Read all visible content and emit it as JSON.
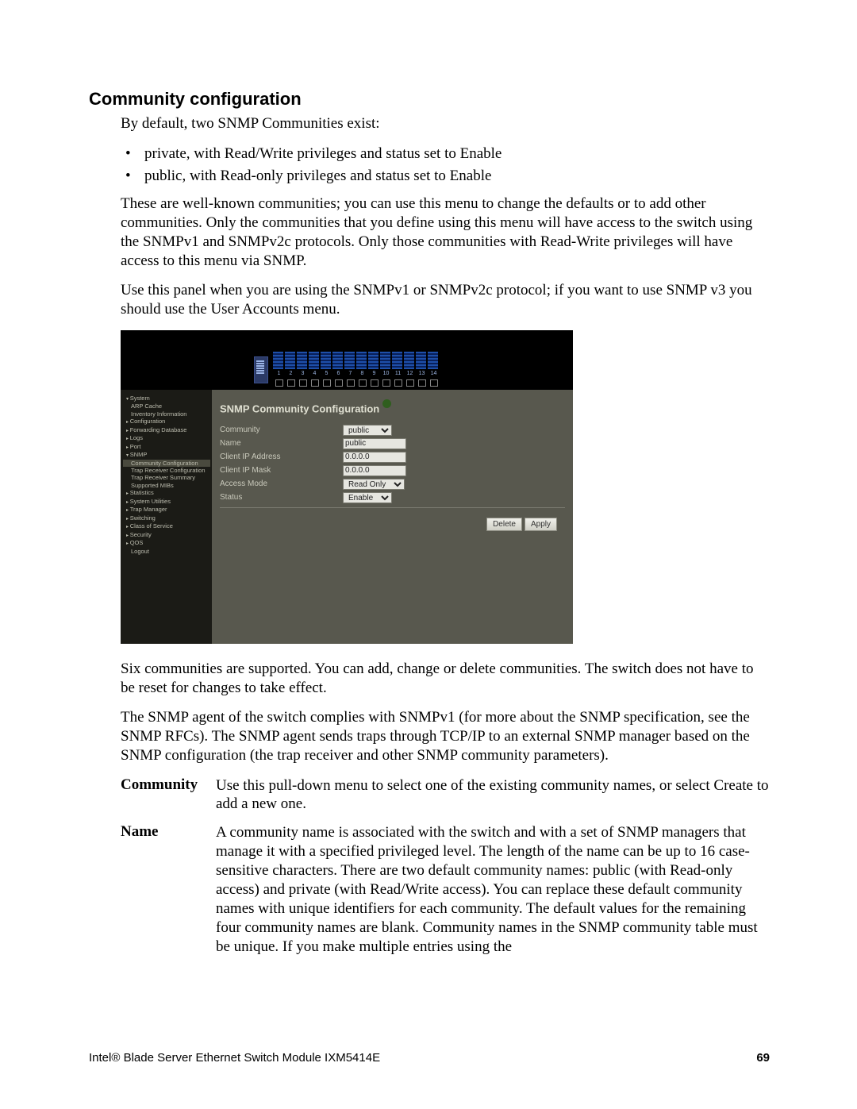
{
  "section_title": "Community configuration",
  "intro": "By default, two SNMP Communities exist:",
  "bullets": [
    "private, with Read/Write privileges and status set to Enable",
    "public, with Read-only privileges and status set to Enable"
  ],
  "para1": "These are well-known communities; you can use this menu to change the defaults or to add other communities. Only the communities that you define using this menu will have access to the switch using the SNMPv1 and SNMPv2c protocols. Only those communities with Read-Write privileges will have access to this menu via SNMP.",
  "para2": "Use this panel when you are using the SNMPv1 or SNMPv2c protocol; if you want to use SNMP v3 you should use the User Accounts menu.",
  "para3": "Six communities are supported. You can add, change or delete communities. The switch does not have to be reset for changes to take effect.",
  "para4": "The SNMP agent of the switch complies with SNMPv1 (for more about the SNMP specification, see the SNMP RFCs). The SNMP agent sends traps through TCP/IP to an external SNMP manager based on the SNMP configuration (the trap receiver and other SNMP community parameters).",
  "ports": [
    "1",
    "2",
    "3",
    "4",
    "5",
    "6",
    "7",
    "8",
    "9",
    "10",
    "11",
    "12",
    "13",
    "14"
  ],
  "nav_items": [
    {
      "label": "System",
      "cls": "n1 trid"
    },
    {
      "label": "ARP Cache",
      "cls": "n2"
    },
    {
      "label": "Inventory Information",
      "cls": "n2"
    },
    {
      "label": "Configuration",
      "cls": "n1 tri"
    },
    {
      "label": "Forwarding Database",
      "cls": "n1 tri"
    },
    {
      "label": "Logs",
      "cls": "n1 tri"
    },
    {
      "label": "Port",
      "cls": "n1 tri"
    },
    {
      "label": "SNMP",
      "cls": "n1 trid"
    },
    {
      "label": "Community Configuration",
      "cls": "n2 sel"
    },
    {
      "label": "Trap Receiver Configuration",
      "cls": "n2"
    },
    {
      "label": "Trap Receiver Summary",
      "cls": "n2"
    },
    {
      "label": "Supported MIBs",
      "cls": "n2"
    },
    {
      "label": "Statistics",
      "cls": "n1 tri"
    },
    {
      "label": "System Utilities",
      "cls": "n1 tri"
    },
    {
      "label": "Trap Manager",
      "cls": "n1 tri"
    },
    {
      "label": "Switching",
      "cls": "n1 tri"
    },
    {
      "label": "Class of Service",
      "cls": "n1 tri"
    },
    {
      "label": "Security",
      "cls": "n1 tri"
    },
    {
      "label": "QOS",
      "cls": "n1 tri"
    },
    {
      "label": "Logout",
      "cls": "n2"
    }
  ],
  "panel": {
    "title": "SNMP Community Configuration",
    "fields": {
      "community_label": "Community",
      "community_value": "public",
      "name_label": "Name",
      "name_value": "public",
      "clientip_label": "Client IP Address",
      "clientip_value": "0.0.0.0",
      "mask_label": "Client IP Mask",
      "mask_value": "0.0.0.0",
      "access_label": "Access Mode",
      "access_value": "Read Only",
      "status_label": "Status",
      "status_value": "Enable"
    },
    "buttons": {
      "delete": "Delete",
      "apply": "Apply"
    }
  },
  "defs": {
    "community": {
      "term": "Community",
      "body": "Use this pull-down menu to select one of the existing community names, or select Create to add a new one."
    },
    "name": {
      "term": "Name",
      "body": "A community name is associated with the switch and with a set of SNMP managers that manage it with a specified privileged level. The length of the name can be up to 16 case-sensitive characters. There are two default community names: public (with Read-only access) and private (with Read/Write access). You can replace these default community names with unique identifiers for each community. The default values for the remaining four community names are blank. Community names in the SNMP community table must be unique. If you make multiple entries using the"
    }
  },
  "footer": {
    "product": "Intel® Blade Server Ethernet Switch Module IXM5414E",
    "page": "69"
  }
}
